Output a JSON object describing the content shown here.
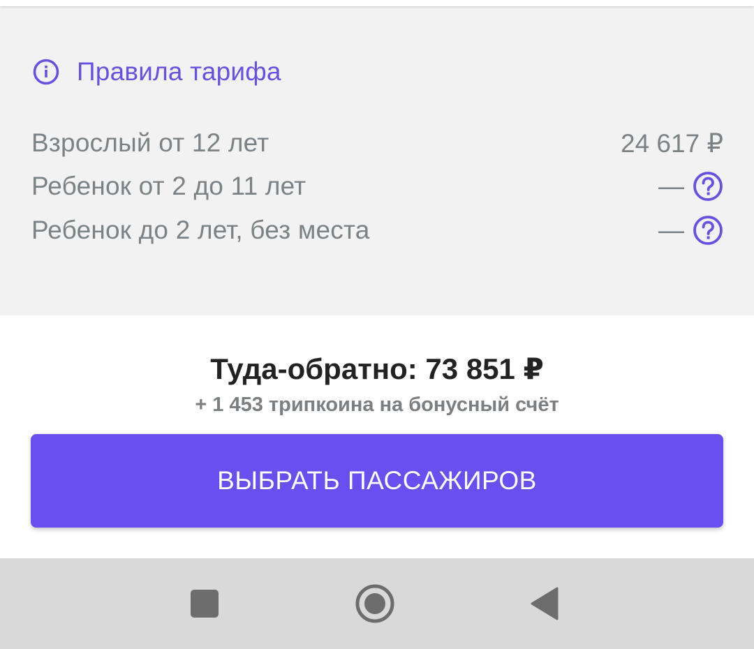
{
  "fare_rules": {
    "link_label": "Правила тарифа",
    "icon": "info-circle-icon",
    "rows": [
      {
        "name": "Взрослый от 12 лет",
        "price": "24 617 ₽"
      },
      {
        "name": "Ребенок от 2 до 11 лет",
        "price": "—",
        "help_icon": "question-circle-icon"
      },
      {
        "name": "Ребенок до 2 лет, без места",
        "price": "—",
        "help_icon": "question-circle-icon"
      }
    ]
  },
  "summary": {
    "total": "Туда-обратно: 73 851 ₽",
    "bonus": "+ 1 453 трипкоина на бонусный счёт",
    "cta_label": "ВЫБРАТЬ ПАССАЖИРОВ"
  },
  "navbar": {
    "recents_icon": "square-icon",
    "home_icon": "circle-home-icon",
    "back_icon": "triangle-back-icon"
  },
  "colors": {
    "accent": "#6a4ff0",
    "link": "#6a4fe3",
    "muted_text": "#7b8286",
    "panel_bg": "#f2f2f2",
    "nav_bg": "#d9d9d9"
  }
}
